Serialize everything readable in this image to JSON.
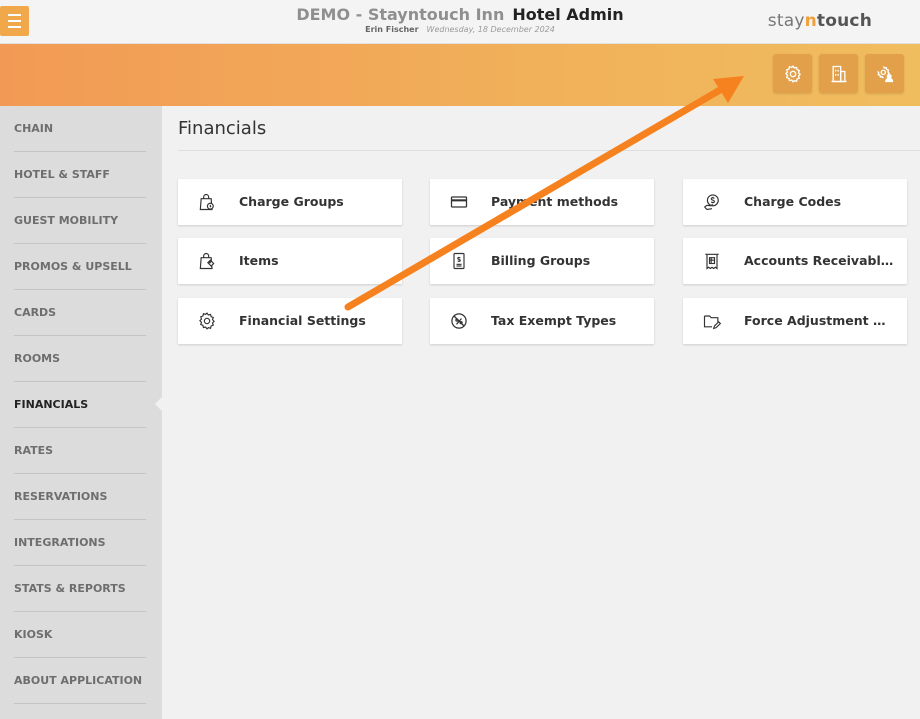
{
  "header": {
    "menu_icon": "hamburger-icon",
    "hotel_name": "DEMO - Stayntouch Inn",
    "app_name": "Hotel Admin",
    "user_name": "Erin Fischer",
    "date": "Wednesday, 18 December 2024",
    "logo": {
      "part1": "stay",
      "part2": "n",
      "part3": "touch"
    }
  },
  "banner": {
    "buttons": [
      {
        "icon": "settings-gear-icon"
      },
      {
        "icon": "building-icon"
      },
      {
        "icon": "user-settings-icon"
      }
    ],
    "colors": {
      "start": "#f29a55",
      "end": "#f0bd5e",
      "button": "#e3a04a"
    }
  },
  "sidebar": {
    "items": [
      {
        "label": "CHAIN"
      },
      {
        "label": "HOTEL & STAFF"
      },
      {
        "label": "GUEST MOBILITY"
      },
      {
        "label": "PROMOS & UPSELL"
      },
      {
        "label": "CARDS"
      },
      {
        "label": "ROOMS"
      },
      {
        "label": "FINANCIALS",
        "active": true
      },
      {
        "label": "RATES"
      },
      {
        "label": "RESERVATIONS"
      },
      {
        "label": "INTEGRATIONS"
      },
      {
        "label": "STATS & REPORTS"
      },
      {
        "label": "KIOSK"
      },
      {
        "label": "ABOUT APPLICATION"
      }
    ]
  },
  "main": {
    "title": "Financials",
    "cards": [
      {
        "label": "Charge Groups",
        "icon": "shopping-bag-icon"
      },
      {
        "label": "Payment methods",
        "icon": "credit-card-icon"
      },
      {
        "label": "Charge Codes",
        "icon": "money-hand-icon"
      },
      {
        "label": "Items",
        "icon": "bag-tag-icon"
      },
      {
        "label": "Billing Groups",
        "icon": "invoice-icon"
      },
      {
        "label": "Accounts Receivables",
        "icon": "receipt-icon"
      },
      {
        "label": "Financial Settings",
        "icon": "gear-icon"
      },
      {
        "label": "Tax Exempt Types",
        "icon": "no-tax-icon"
      },
      {
        "label": "Force Adjustment Reasons",
        "icon": "folder-edit-icon"
      }
    ]
  },
  "annotation": {
    "type": "arrow",
    "color": "#f5821f"
  }
}
